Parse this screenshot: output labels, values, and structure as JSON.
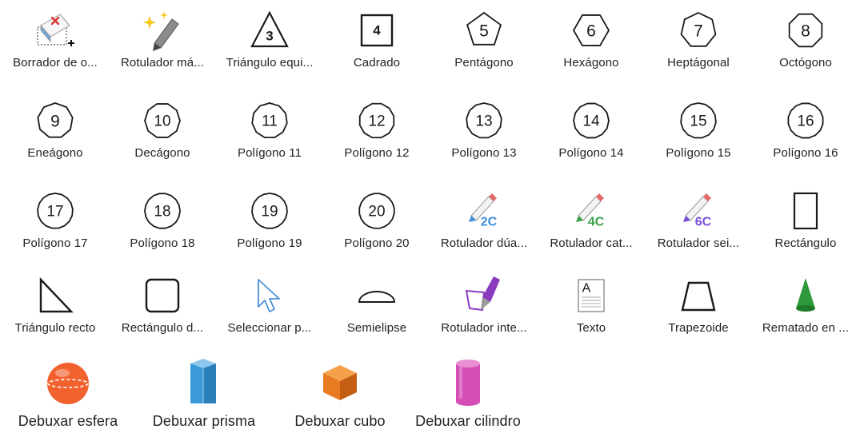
{
  "tools": [
    {
      "label": "Borrador de o...",
      "icon": "eraser-selection-icon"
    },
    {
      "label": "Rotulador má...",
      "icon": "magic-marker-icon"
    },
    {
      "label": "Triángulo equi...",
      "icon": "triangle-3-icon",
      "text": "3"
    },
    {
      "label": "Cadrado",
      "icon": "square-4-icon",
      "text": "4"
    },
    {
      "label": "Pentágono",
      "icon": "pentagon-5-icon",
      "text": "5"
    },
    {
      "label": "Hexágono",
      "icon": "hexagon-6-icon",
      "text": "6"
    },
    {
      "label": "Heptágonal",
      "icon": "heptagon-7-icon",
      "text": "7"
    },
    {
      "label": "Octógono",
      "icon": "octagon-8-icon",
      "text": "8"
    },
    {
      "label": "Eneágono",
      "icon": "polygon-9-icon",
      "text": "9"
    },
    {
      "label": "Decágono",
      "icon": "polygon-10-icon",
      "text": "10"
    },
    {
      "label": "Polígono 11",
      "icon": "polygon-11-icon",
      "text": "11"
    },
    {
      "label": "Polígono 12",
      "icon": "polygon-12-icon",
      "text": "12"
    },
    {
      "label": "Polígono 13",
      "icon": "polygon-13-icon",
      "text": "13"
    },
    {
      "label": "Polígono 14",
      "icon": "polygon-14-icon",
      "text": "14"
    },
    {
      "label": "Polígono 15",
      "icon": "polygon-15-icon",
      "text": "15"
    },
    {
      "label": "Polígono 16",
      "icon": "polygon-16-icon",
      "text": "16"
    },
    {
      "label": "Polígono 17",
      "icon": "polygon-17-icon",
      "text": "17"
    },
    {
      "label": "Polígono 18",
      "icon": "polygon-18-icon",
      "text": "18"
    },
    {
      "label": "Polígono 19",
      "icon": "polygon-19-icon",
      "text": "19"
    },
    {
      "label": "Polígono 20",
      "icon": "polygon-20-icon",
      "text": "20"
    },
    {
      "label": "Rotulador dúa...",
      "icon": "marker-2c-icon",
      "text": "2C",
      "color": "#3d8fd9"
    },
    {
      "label": "Rotulador cat...",
      "icon": "marker-4c-icon",
      "text": "4C",
      "color": "#3da34a"
    },
    {
      "label": "Rotulador sei...",
      "icon": "marker-6c-icon",
      "text": "6C",
      "color": "#7a4fd6"
    },
    {
      "label": "Rectángulo",
      "icon": "rectangle-icon"
    },
    {
      "label": "Triángulo recto",
      "icon": "right-triangle-icon"
    },
    {
      "label": "Rectángulo d...",
      "icon": "rounded-rectangle-icon"
    },
    {
      "label": "Seleccionar p...",
      "icon": "select-pointer-icon"
    },
    {
      "label": "Semielipse",
      "icon": "semi-ellipse-icon"
    },
    {
      "label": "Rotulador inte...",
      "icon": "intelligent-marker-icon"
    },
    {
      "label": "Texto",
      "icon": "text-icon",
      "text": "A"
    },
    {
      "label": "Trapezoide",
      "icon": "trapezoid-icon"
    },
    {
      "label": "Rematado en ...",
      "icon": "cone-icon"
    }
  ],
  "big_tools": [
    {
      "label": "Debuxar esfera",
      "icon": "sphere-icon"
    },
    {
      "label": "Debuxar prisma",
      "icon": "prism-icon"
    },
    {
      "label": "Debuxar cubo",
      "icon": "cube-icon"
    },
    {
      "label": "Debuxar cilindro",
      "icon": "cylinder-icon"
    }
  ],
  "colors": {
    "sphere": "#f2622e",
    "prism": "#3a9ad9",
    "cube": "#e87a22",
    "cylinder": "#d64fb5",
    "cone": "#2e9a3c",
    "select_pointer": "#4a90d9",
    "intelligent_marker": "#8a3bbf"
  }
}
